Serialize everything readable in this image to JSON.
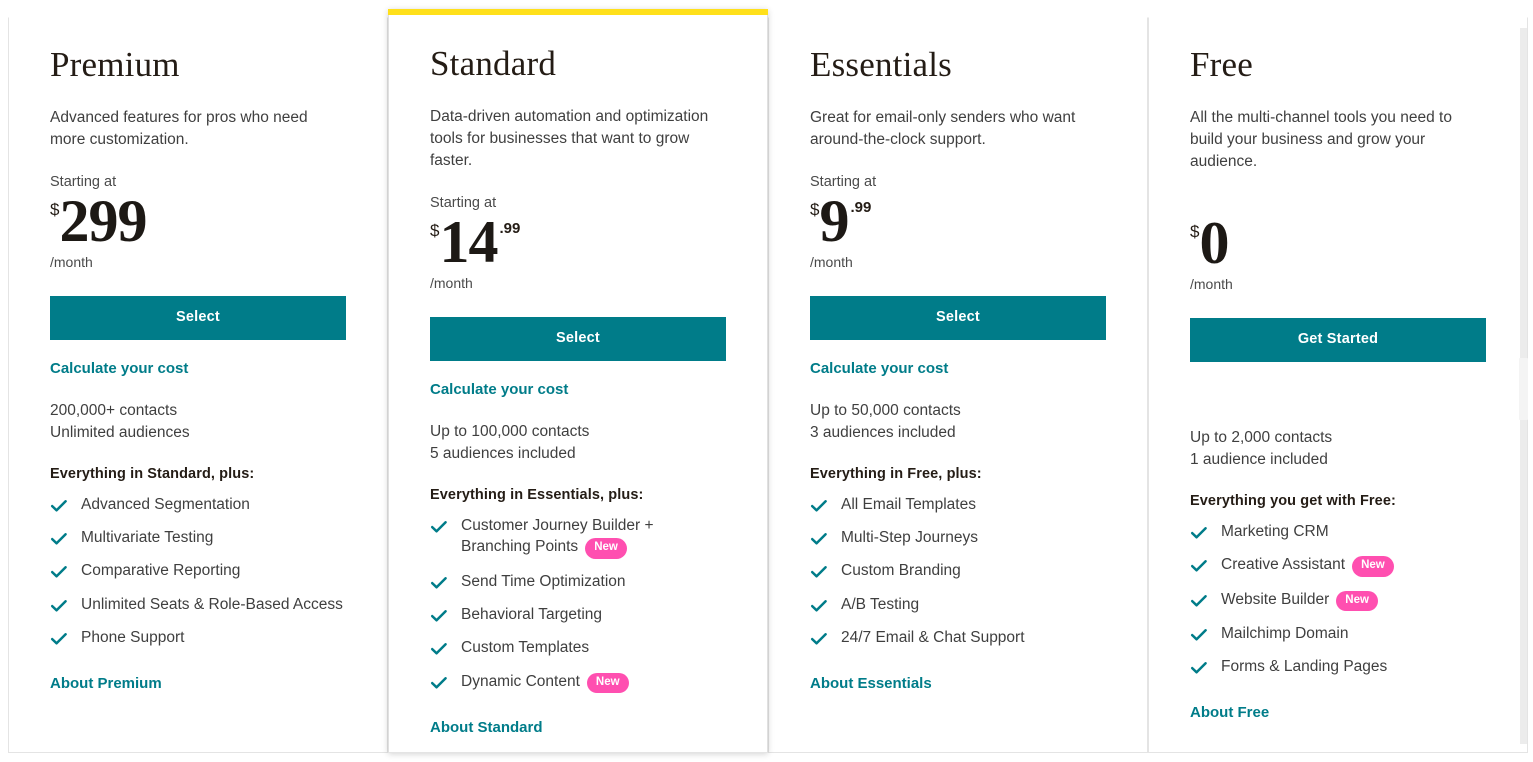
{
  "page": {
    "accent_teal": "#007c89",
    "highlight_yellow": "#ffe01b",
    "badge_pink": "#ff4fb0"
  },
  "plans": [
    {
      "id": "premium",
      "title": "Premium",
      "description": "Advanced features for pros who need more customization.",
      "starting_at": "Starting at",
      "currency": "$",
      "amount": "299",
      "cents": "",
      "period": "/month",
      "cta_label": "Select",
      "calculate_link": "Calculate your cost",
      "contacts": "200,000+ contacts",
      "audiences": "Unlimited audiences",
      "everything_label": "Everything in Standard, plus:",
      "features": [
        {
          "text": "Advanced Segmentation",
          "badge": ""
        },
        {
          "text": "Multivariate Testing",
          "badge": ""
        },
        {
          "text": "Comparative Reporting",
          "badge": ""
        },
        {
          "text": "Unlimited Seats & Role-Based Access",
          "badge": ""
        },
        {
          "text": "Phone Support",
          "badge": ""
        }
      ],
      "about_link": "About Premium",
      "highlighted": false
    },
    {
      "id": "standard",
      "title": "Standard",
      "description": "Data-driven automation and optimization tools for businesses that want to grow faster.",
      "starting_at": "Starting at",
      "currency": "$",
      "amount": "14",
      "cents": ".99",
      "period": "/month",
      "cta_label": "Select",
      "calculate_link": "Calculate your cost",
      "contacts": "Up to 100,000 contacts",
      "audiences": "5 audiences included",
      "everything_label": "Everything in Essentials, plus:",
      "features": [
        {
          "text": "Customer Journey Builder + Branching Points",
          "badge": "New"
        },
        {
          "text": "Send Time Optimization",
          "badge": ""
        },
        {
          "text": "Behavioral Targeting",
          "badge": ""
        },
        {
          "text": "Custom Templates",
          "badge": ""
        },
        {
          "text": "Dynamic Content",
          "badge": "New"
        }
      ],
      "about_link": "About Standard",
      "highlighted": true
    },
    {
      "id": "essentials",
      "title": "Essentials",
      "description": "Great for email-only senders who want around-the-clock support.",
      "starting_at": "Starting at",
      "currency": "$",
      "amount": "9",
      "cents": ".99",
      "period": "/month",
      "cta_label": "Select",
      "calculate_link": "Calculate your cost",
      "contacts": "Up to 50,000 contacts",
      "audiences": "3 audiences included",
      "everything_label": "Everything in Free, plus:",
      "features": [
        {
          "text": "All Email Templates",
          "badge": ""
        },
        {
          "text": "Multi-Step Journeys",
          "badge": ""
        },
        {
          "text": "Custom Branding",
          "badge": ""
        },
        {
          "text": "A/B Testing",
          "badge": ""
        },
        {
          "text": "24/7 Email & Chat Support",
          "badge": ""
        }
      ],
      "about_link": "About Essentials",
      "highlighted": false
    },
    {
      "id": "free",
      "title": "Free",
      "description": "All the multi-channel tools you need to build your business and grow your audience.",
      "starting_at": "",
      "currency": "$",
      "amount": "0",
      "cents": "",
      "period": "/month",
      "cta_label": "Get Started",
      "calculate_link": "",
      "contacts": "Up to 2,000 contacts",
      "audiences": "1 audience included",
      "everything_label": "Everything you get with Free:",
      "features": [
        {
          "text": "Marketing CRM",
          "badge": ""
        },
        {
          "text": "Creative Assistant",
          "badge": "New"
        },
        {
          "text": "Website Builder",
          "badge": "New"
        },
        {
          "text": "Mailchimp Domain",
          "badge": ""
        },
        {
          "text": "Forms & Landing Pages",
          "badge": ""
        }
      ],
      "about_link": "About Free",
      "highlighted": false
    }
  ]
}
